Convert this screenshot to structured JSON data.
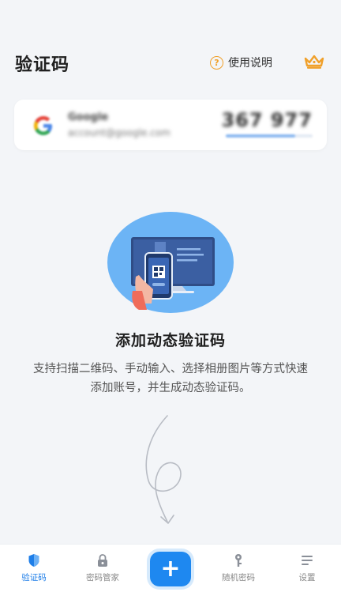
{
  "header": {
    "title": "验证码",
    "help_label": "使用说明",
    "help_icon_glyph": "?"
  },
  "account_card": {
    "service_name": "Google",
    "account": "account@google.com",
    "code": "367 977",
    "progress": 0.8
  },
  "empty_state": {
    "title": "添加动态验证码",
    "description": "支持扫描二维码、手动输入、选择相册图片等方式快速添加账号，并生成动态验证码。"
  },
  "tabbar": {
    "items": [
      {
        "label": "验证码",
        "icon": "shield-icon",
        "active": true
      },
      {
        "label": "密码管家",
        "icon": "lock-icon",
        "active": false
      },
      {
        "label": "随机密码",
        "icon": "key-icon",
        "active": false
      },
      {
        "label": "设置",
        "icon": "menu-icon",
        "active": false
      }
    ],
    "add_glyph": "+"
  },
  "colors": {
    "accent": "#1e88f0",
    "crown": "#f0a02a",
    "background": "#f3f5f8"
  }
}
